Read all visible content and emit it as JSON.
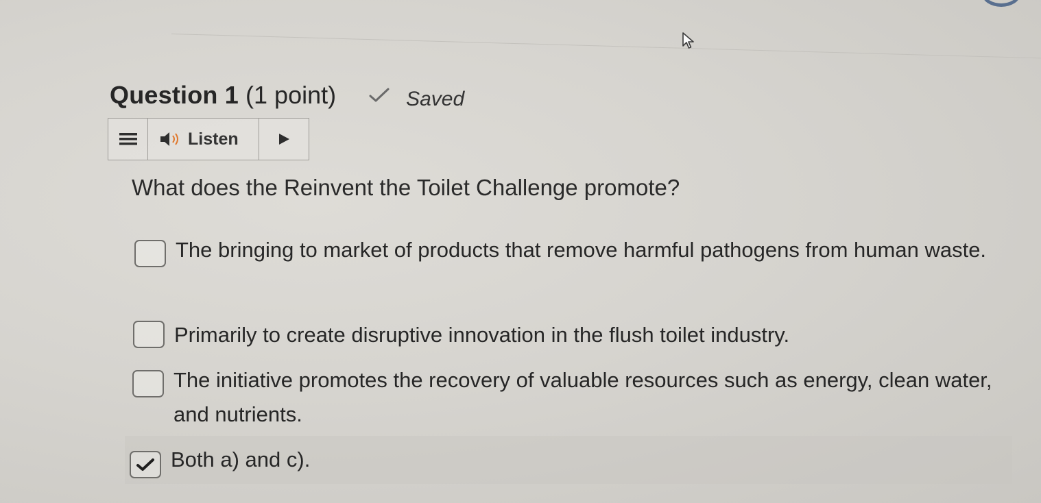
{
  "question": {
    "title": "Question 1",
    "points": "(1 point)",
    "status": "Saved",
    "status_icon": "checkmark-icon",
    "prompt": "What does the Reinvent the Toilet Challenge promote?"
  },
  "listen_toolbar": {
    "menu_icon": "hamburger-menu-icon",
    "speaker_icon": "speaker-icon",
    "listen_label": "Listen",
    "play_icon": "play-icon"
  },
  "options": [
    {
      "text": "The bringing to market of products that remove harmful pathogens from human waste.",
      "checked": false
    },
    {
      "text": "Primarily to create disruptive innovation in the flush toilet industry.",
      "checked": false
    },
    {
      "text": "The initiative promotes the recovery of valuable resources such as energy, clean water, and nutrients.",
      "checked": false
    },
    {
      "text": "Both a) and c).",
      "checked": true
    }
  ]
}
